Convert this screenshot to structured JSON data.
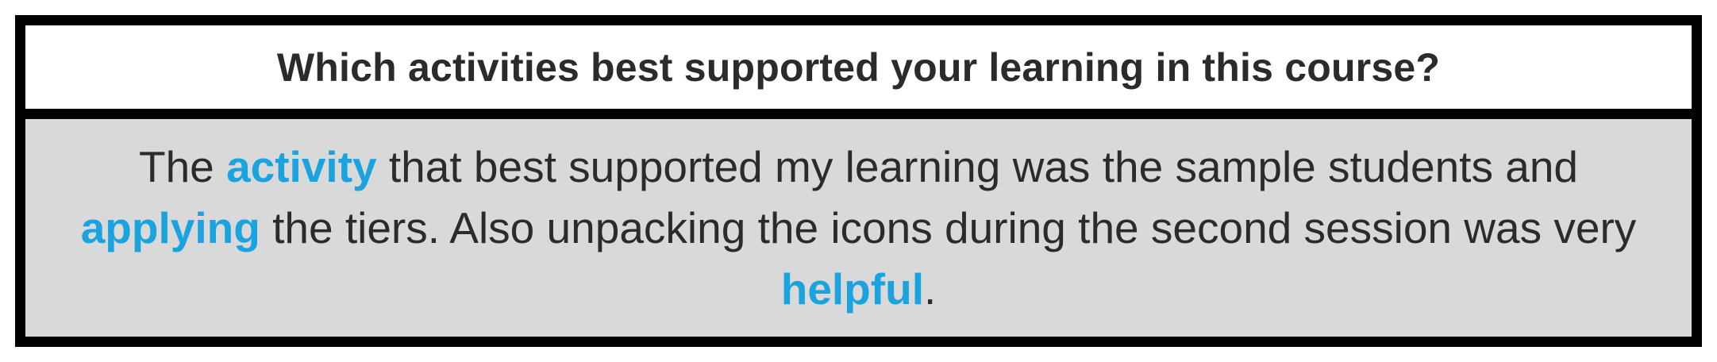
{
  "question": "Which activities best supported your learning in this course?",
  "answer": {
    "segments": [
      {
        "text": "The ",
        "highlight": false
      },
      {
        "text": "activity",
        "highlight": true
      },
      {
        "text": " that best supported my learning was the sample students and ",
        "highlight": false
      },
      {
        "text": "applying",
        "highlight": true
      },
      {
        "text": " the tiers. Also unpacking the icons during the second session was very ",
        "highlight": false
      },
      {
        "text": "helpful",
        "highlight": true
      },
      {
        "text": ".",
        "highlight": false
      }
    ]
  },
  "colors": {
    "border": "#000000",
    "question_bg": "#ffffff",
    "answer_bg": "#d9d9d9",
    "text": "#2b2b2b",
    "highlight": "#1ba3e0"
  }
}
